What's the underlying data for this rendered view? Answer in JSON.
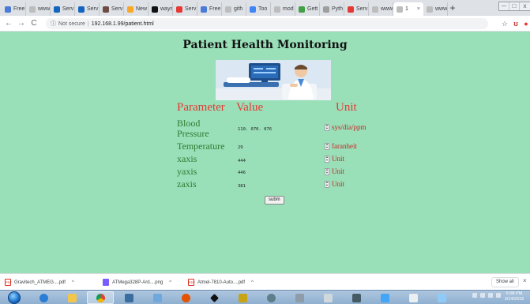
{
  "browser": {
    "tabs": [
      {
        "label": "Free",
        "color": "#4a7bd6"
      },
      {
        "label": "www",
        "color": "#bdbdbd"
      },
      {
        "label": "Serv",
        "color": "#1565c0"
      },
      {
        "label": "Serv",
        "color": "#1565c0"
      },
      {
        "label": "Serv",
        "color": "#6d4c41"
      },
      {
        "label": "New",
        "color": "#f9a825"
      },
      {
        "label": "ways",
        "color": "#111111"
      },
      {
        "label": "Serv",
        "color": "#e53935"
      },
      {
        "label": "Free",
        "color": "#4a7bd6"
      },
      {
        "label": "gith",
        "color": "#bdbdbd"
      },
      {
        "label": "Too",
        "color": "#4285f4"
      },
      {
        "label": "mod",
        "color": "#bdbdbd"
      },
      {
        "label": "Gett",
        "color": "#43a047"
      },
      {
        "label": "Pyth",
        "color": "#9e9e9e"
      },
      {
        "label": "Serv",
        "color": "#e53935"
      },
      {
        "label": "www",
        "color": "#bdbdbd"
      },
      {
        "label": "1",
        "color": "#bdbdbd"
      },
      {
        "label": "www",
        "color": "#bdbdbd"
      }
    ],
    "new_tab": "+",
    "window_controls": {
      "minimize": "─",
      "maximize": "□",
      "close": "x"
    },
    "nav": {
      "back": "←",
      "forward": "→",
      "reload": "C"
    },
    "security": "Not secure",
    "url": "192.168.1.99/patient.html"
  },
  "page": {
    "title": "Patient Health Monitoring",
    "headers": {
      "parameter": "Parameter",
      "value": "Value",
      "unit": "Unit"
    },
    "rows": [
      {
        "label": "Blood Pressure",
        "value": "110. 070. 076",
        "unit": "sys/dia/ppm"
      },
      {
        "label": "Temperature",
        "value": "29",
        "unit": "faranheit"
      },
      {
        "label": "xaxis",
        "value": "444",
        "unit": "Unit"
      },
      {
        "label": "yaxis",
        "value": "446",
        "unit": "Unit"
      },
      {
        "label": "zaxis",
        "value": "381",
        "unit": "Unit"
      }
    ],
    "submit_label": "subm",
    "background": "#99dfb8",
    "header_color": "#e53935",
    "label_color": "#2e7d32"
  },
  "downloads": {
    "items": [
      {
        "name": "Gravitech_ATMEG....pdf",
        "icon": "pdf-icon"
      },
      {
        "name": "ATMega328P-Ard....png",
        "icon": "image-icon"
      },
      {
        "name": "Atmel-7810-Auto....pdf",
        "icon": "pdf-icon"
      }
    ],
    "show_all": "Show all"
  },
  "taskbar": {
    "time": "6:08 PM",
    "date": "3/14/2018"
  }
}
